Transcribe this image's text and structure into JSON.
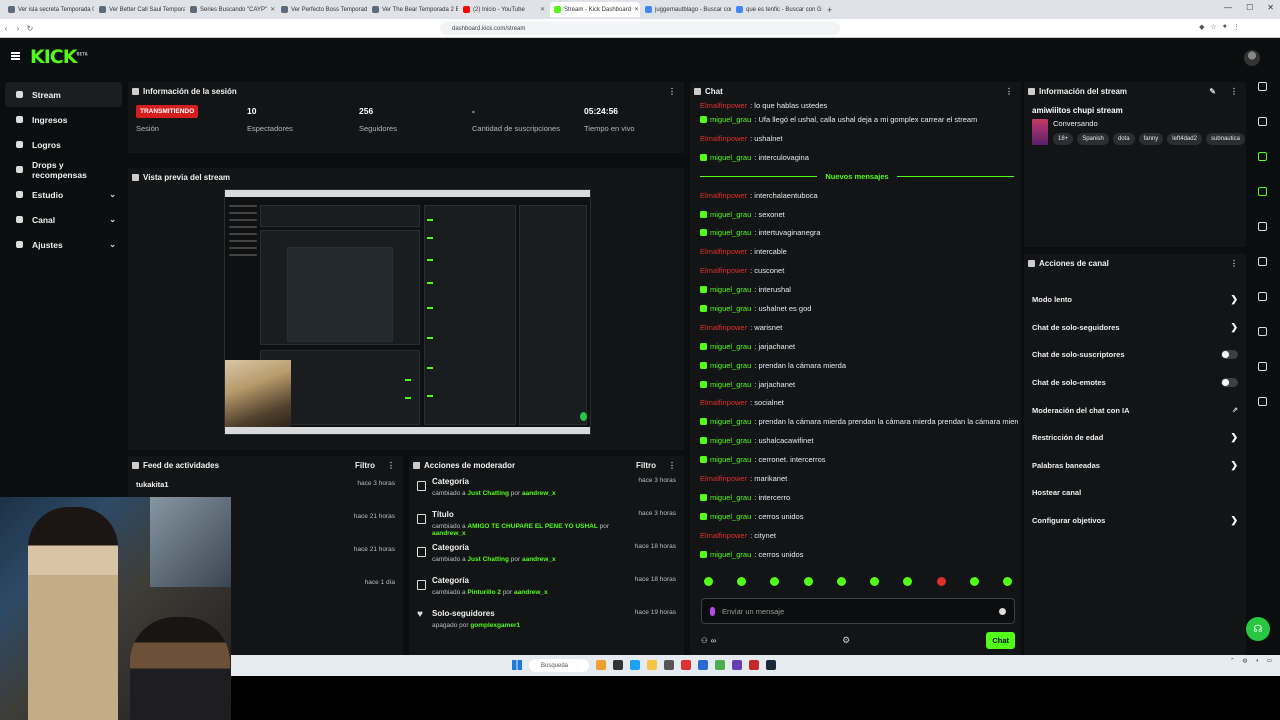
{
  "browser": {
    "tabs": [
      {
        "label": "Ver isla secreta Temporada 0 Cap...",
        "icon_color": "#5b6b7a"
      },
      {
        "label": "Ver Better Call Saul Temporada 2 Ep...",
        "icon_color": "#5b6b7a"
      },
      {
        "label": "Series Buscando \"CAYP\"",
        "icon_color": "#5b6b7a"
      },
      {
        "label": "Ver Perfecto Boss Temporada 2 Episo...",
        "icon_color": "#5b6b7a"
      },
      {
        "label": "Ver The Bear Temporada 2 Episodio...",
        "icon_color": "#5b6b7a"
      },
      {
        "label": "(2) Inicio - YouTube",
        "icon_color": "#ff0000"
      },
      {
        "label": "Stream - Kick Dashboard",
        "icon_color": "#53fc18"
      },
      {
        "label": "juggernautblago - Buscar con Google",
        "icon_color": "#4285f4"
      },
      {
        "label": "que es tenfic - Buscar con Google",
        "icon_color": "#4285f4"
      }
    ],
    "new_tab": "+",
    "url": "dashboard.kick.com/stream"
  },
  "app": {
    "logo": "KICK",
    "logo_sup": "BETA"
  },
  "sidebar": {
    "items": [
      {
        "label": "Stream",
        "icon": "stream-icon",
        "active": true,
        "chevron": ""
      },
      {
        "label": "Ingresos",
        "icon": "income-icon",
        "active": false,
        "chevron": ""
      },
      {
        "label": "Logros",
        "icon": "achievements-icon",
        "active": false,
        "chevron": ""
      },
      {
        "label": "Drops y recompensas",
        "icon": "drops-icon",
        "active": false,
        "chevron": ""
      },
      {
        "label": "Estudio",
        "icon": "studio-icon",
        "active": false,
        "chevron": "⌄"
      },
      {
        "label": "Canal",
        "icon": "channel-icon",
        "active": false,
        "chevron": "⌄"
      },
      {
        "label": "Ajustes",
        "icon": "settings-icon",
        "active": false,
        "chevron": "⌄"
      }
    ]
  },
  "session": {
    "title": "Información de la sesión",
    "status": "TRANSMITIENDO",
    "status_label": "Sesión",
    "viewers": "10",
    "viewers_label": "Espectadores",
    "followers": "256",
    "followers_label": "Seguidores",
    "subs": "-",
    "subs_label": "Cantidad de suscripciones",
    "live_time": "05:24:56",
    "live_time_label": "Tiempo en vivo"
  },
  "preview": {
    "title": "Vista previa del stream"
  },
  "feed": {
    "title": "Feed de actividades",
    "filter": "Filtro",
    "rows": [
      {
        "name": "tukakita1",
        "time": "hace 3 horas"
      },
      {
        "name": "",
        "time": "hace 21 horas"
      },
      {
        "name": "",
        "time": "hace 21 horas"
      },
      {
        "name": "",
        "time": "hace 1 día"
      }
    ]
  },
  "mod": {
    "title": "Acciones de moderador",
    "filter": "Filtro",
    "rows": [
      {
        "type": "Categoría",
        "pre": "cambiado a ",
        "value": "Just Chatting",
        "by": " por ",
        "user": "aandrew_x",
        "time": "hace 3 horas",
        "icon": "category-icon"
      },
      {
        "type": "Título",
        "pre": "cambiado a ",
        "value": "AMIGO TE CHUPARE EL PENE YO USHAL",
        "by": " por ",
        "user": "aandrew_x",
        "time": "hace 3 horas",
        "icon": "title-icon"
      },
      {
        "type": "Categoría",
        "pre": "cambiado a ",
        "value": "Just Chatting",
        "by": " por ",
        "user": "aandrew_x",
        "time": "hace 18 horas",
        "icon": "category-icon"
      },
      {
        "type": "Categoría",
        "pre": "cambiado a ",
        "value": "Pinturillo 2",
        "by": " por ",
        "user": "aandrew_x",
        "time": "hace 18 horas",
        "icon": "category-icon"
      },
      {
        "type": "Solo-seguidores",
        "pre": "apagado por ",
        "value": "",
        "by": "",
        "user": "gomplexgamer1",
        "time": "hace 19 horas",
        "icon": "heart-icon"
      }
    ]
  },
  "chat": {
    "title": "Chat",
    "new_messages": "Nuevos mensajes",
    "messages_before": [
      {
        "user": "Elmalfinpower",
        "color": "red",
        "text": ": lo que hablas ustedes"
      },
      {
        "user": "miguel_grau",
        "color": "green",
        "text": ": Ufa llegó el ushal, calla ushal deja a mi gomplex carrear el stream"
      },
      {
        "user": "Elmalfinpower",
        "color": "red",
        "text": ": ushalnet"
      },
      {
        "user": "miguel_grau",
        "color": "green",
        "text": ": interculovagina"
      }
    ],
    "messages_after": [
      {
        "user": "Elmalfinpower",
        "color": "red",
        "text": ": interchalaentuboca"
      },
      {
        "user": "miguel_grau",
        "color": "green",
        "text": ": sexonet"
      },
      {
        "user": "miguel_grau",
        "color": "green",
        "text": ": intertuvaginanegra"
      },
      {
        "user": "Elmalfinpower",
        "color": "red",
        "text": ": intercable"
      },
      {
        "user": "Elmalfinpower",
        "color": "red",
        "text": ": cusconet"
      },
      {
        "user": "miguel_grau",
        "color": "green",
        "text": ": interushal"
      },
      {
        "user": "miguel_grau",
        "color": "green",
        "text": ": ushalnet es god"
      },
      {
        "user": "Elmalfinpower",
        "color": "red",
        "text": ": warisnet"
      },
      {
        "user": "miguel_grau",
        "color": "green",
        "text": ": jarjachanet"
      },
      {
        "user": "miguel_grau",
        "color": "green",
        "text": ": prendan la cámara mierda"
      },
      {
        "user": "miguel_grau",
        "color": "green",
        "text": ": jarjachanet"
      },
      {
        "user": "Elmalfinpower",
        "color": "red",
        "text": ": socialnet"
      },
      {
        "user": "miguel_grau",
        "color": "green",
        "text": ": prendan la cámara mierda prendan la cámara mierda prendan la cámara mierda"
      },
      {
        "user": "miguel_grau",
        "color": "green",
        "text": ": ushalcacawifinet"
      },
      {
        "user": "miguel_grau",
        "color": "green",
        "text": ": cerronet. intercerros"
      },
      {
        "user": "Elmalfinpower",
        "color": "red",
        "text": ": marikanet"
      },
      {
        "user": "miguel_grau",
        "color": "green",
        "text": ": intercerro"
      },
      {
        "user": "miguel_grau",
        "color": "green",
        "text": ": cerros unidos"
      },
      {
        "user": "Elmalfinpower",
        "color": "red",
        "text": ": citynet"
      },
      {
        "user": "miguel_grau",
        "color": "green",
        "text": ": cerros unidos"
      }
    ],
    "emote_colors": [
      "#53fc18",
      "#53fc18",
      "#53fc18",
      "#53fc18",
      "#53fc18",
      "#53fc18",
      "#53fc18",
      "#e0302b",
      "#53fc18",
      "#53fc18"
    ],
    "input_placeholder": "Enviar un mensaje",
    "footer_counter": "∞",
    "send_label": "Chat"
  },
  "stream_info": {
    "title": "Información del stream",
    "stream_title": "amiwiiitos chupi stream",
    "category": "Conversando",
    "tags": [
      "18+",
      "Spanish",
      "dota",
      "fanny",
      "left4dad2",
      "subnautica"
    ]
  },
  "channel_actions": {
    "title": "Acciones de canal",
    "rows": [
      {
        "label": "Modo lento",
        "control": "chevron"
      },
      {
        "label": "Chat de solo-seguidores",
        "control": "chevron"
      },
      {
        "label": "Chat de solo-suscriptores",
        "control": "toggle",
        "on": false
      },
      {
        "label": "Chat de solo-emotes",
        "control": "toggle",
        "on": false
      },
      {
        "label": "Moderación del chat con IA",
        "control": "external"
      },
      {
        "label": "Restricción de edad",
        "control": "chevron"
      },
      {
        "label": "Palabras baneadas",
        "control": "chevron"
      },
      {
        "label": "Hostear canal",
        "control": "none"
      },
      {
        "label": "Configurar objetivos",
        "control": "chevron"
      }
    ]
  },
  "taskbar": {
    "search": "Búsqueda"
  },
  "colors": {
    "accent": "#53fc18",
    "live": "#d51f1f",
    "red_user": "#e0302b"
  }
}
